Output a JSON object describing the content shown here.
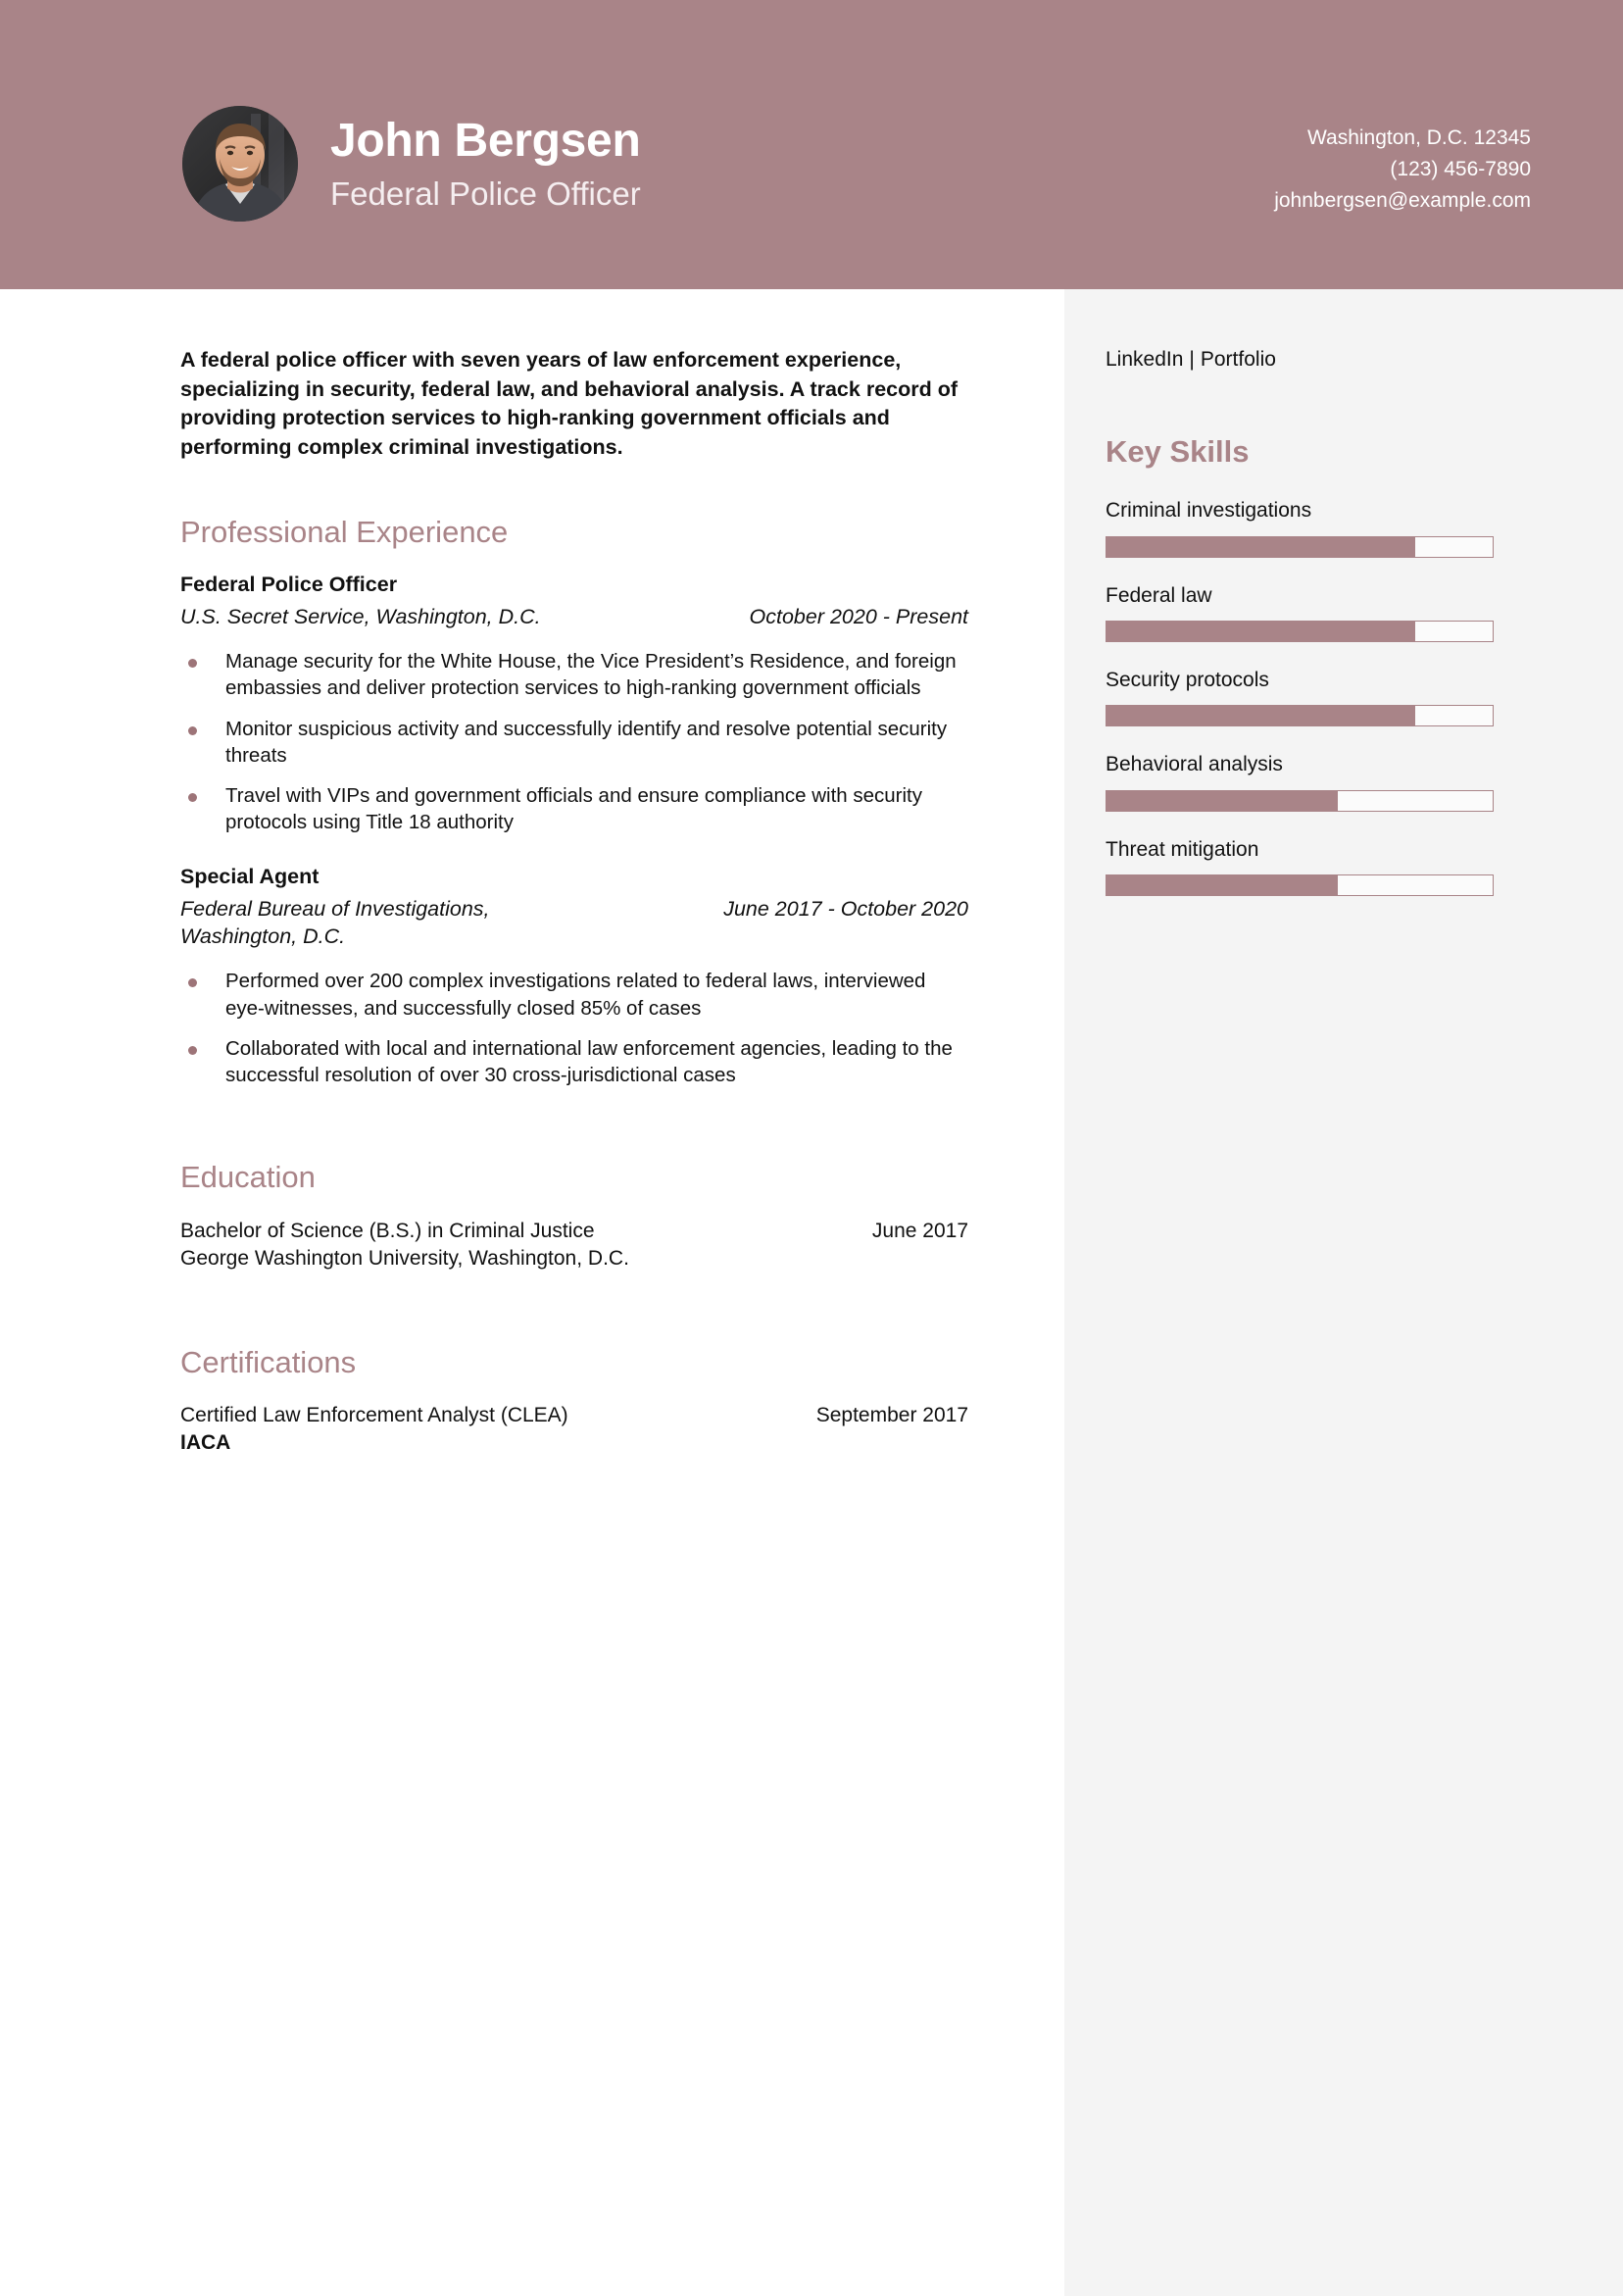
{
  "header": {
    "name": "John Bergsen",
    "role": "Federal Police Officer",
    "contact": {
      "location": "Washington, D.C. 12345",
      "phone": "(123) 456-7890",
      "email": "johnbergsen@example.com"
    },
    "avatar_alt": "profile-photo",
    "background_color": "#a98488",
    "text_color": "#ffffff"
  },
  "main": {
    "summary": "A federal police officer with seven years of law enforcement experience, specializing in security, federal law, and behavioral analysis. A track record of providing protection services to high-ranking government officials and performing complex criminal investigations.",
    "experience": {
      "title": "Professional Experience",
      "jobs": [
        {
          "position": "Federal Police Officer",
          "organization": "U.S. Secret Service, Washington, D.C.",
          "dates": "October 2020 - Present",
          "bullets": [
            "Manage security for the White House, the Vice President’s Residence, and foreign embassies and deliver protection services to high-ranking government officials",
            "Monitor suspicious activity and successfully identify and resolve potential security threats",
            "Travel with VIPs and government officials and ensure compliance with security protocols using Title 18 authority"
          ]
        },
        {
          "position": "Special Agent",
          "organization": "Federal Bureau of Investigations, Washington, D.C.",
          "dates": "June 2017 - October 2020",
          "bullets": [
            "Performed over 200 complex investigations related to federal laws, interviewed eye-witnesses, and successfully closed 85% of cases",
            "Collaborated with local and international law enforcement agencies, leading to the successful resolution of over 30 cross-jurisdictional cases"
          ]
        }
      ]
    },
    "education": {
      "title": "Education",
      "entries": [
        {
          "degree": "Bachelor of Science (B.S.) in Criminal Justice",
          "date": "June 2017",
          "school": "George Washington University, Washington, D.C."
        }
      ]
    },
    "certifications": {
      "title": "Certifications",
      "entries": [
        {
          "name": "Certified Law Enforcement Analyst (CLEA)",
          "date": "September 2017",
          "issuer": "IACA"
        }
      ]
    }
  },
  "sidebar": {
    "links": {
      "linkedin_label": "LinkedIn",
      "separator": "|",
      "portfolio_label": "Portfolio"
    },
    "skills": {
      "title": "Key Skills",
      "accent_color": "#a98488",
      "items": [
        {
          "label": "Criminal investigations",
          "level": 80
        },
        {
          "label": "Federal law",
          "level": 80
        },
        {
          "label": "Security protocols",
          "level": 80
        },
        {
          "label": "Behavioral analysis",
          "level": 60
        },
        {
          "label": "Threat mitigation",
          "level": 60
        }
      ]
    },
    "background_color": "#f4f4f4"
  }
}
